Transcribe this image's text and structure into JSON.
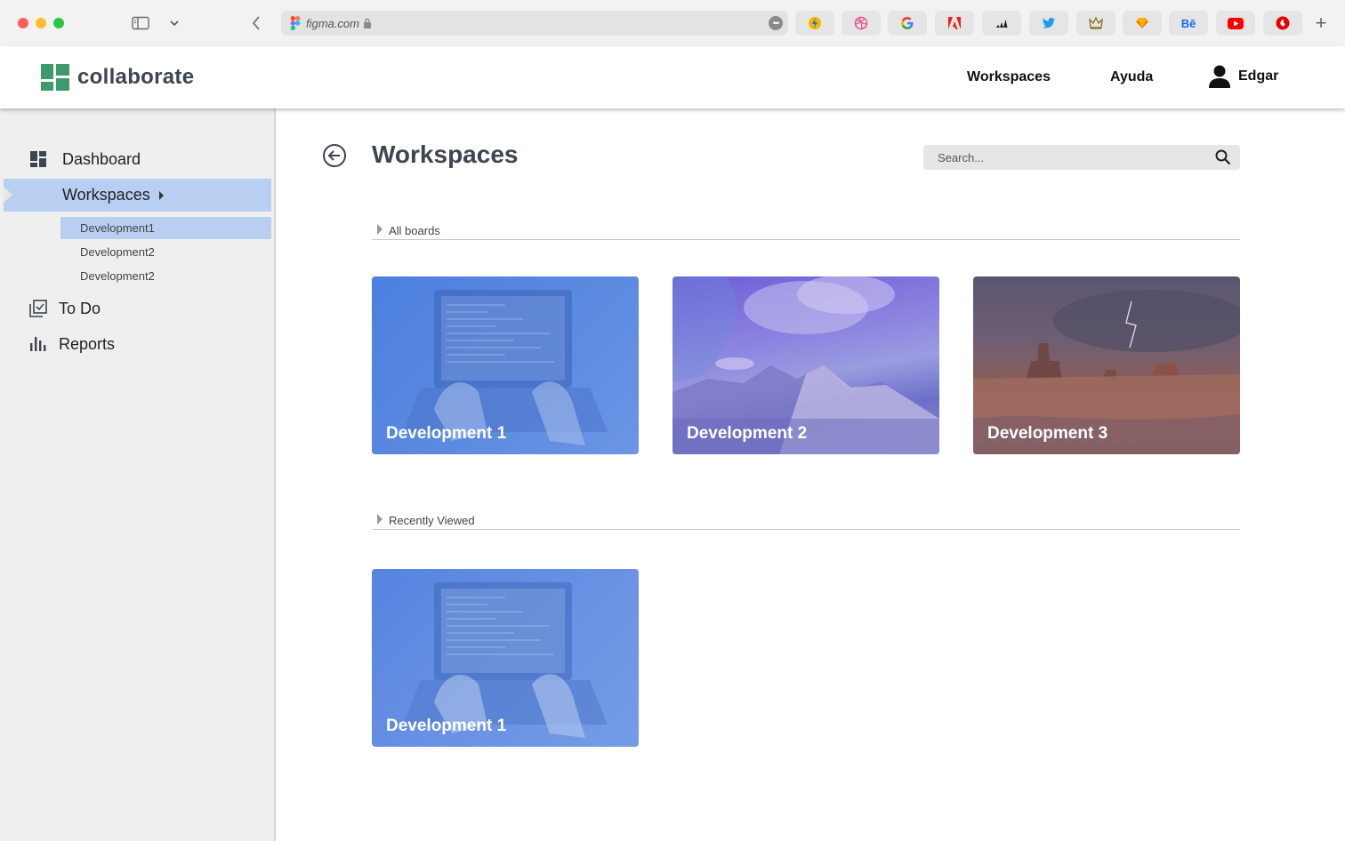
{
  "browser": {
    "url": "figma.com",
    "new_tab_label": "+"
  },
  "header": {
    "app_name": "collaborate",
    "nav": [
      {
        "label": "Workspaces"
      },
      {
        "label": "Ayuda"
      }
    ],
    "user_name": "Edgar"
  },
  "sidebar": {
    "items": [
      {
        "label": "Dashboard"
      },
      {
        "label": "Workspaces"
      },
      {
        "label": "To Do"
      },
      {
        "label": "Reports"
      }
    ],
    "sub_items": [
      {
        "label": "Development1"
      },
      {
        "label": "Development2"
      },
      {
        "label": "Development2"
      }
    ]
  },
  "main": {
    "title": "Workspaces",
    "search_placeholder": "Search...",
    "sections": [
      {
        "label": "All boards",
        "cards": [
          {
            "title": "Development 1"
          },
          {
            "title": "Development 2"
          },
          {
            "title": "Development 3"
          }
        ]
      },
      {
        "label": "Recently Viewed",
        "cards": [
          {
            "title": "Development 1"
          }
        ]
      }
    ]
  },
  "colors": {
    "accent_blue": "#b8cff2",
    "brand_green": "#3e9a6b",
    "title_gray": "#3d4550"
  }
}
